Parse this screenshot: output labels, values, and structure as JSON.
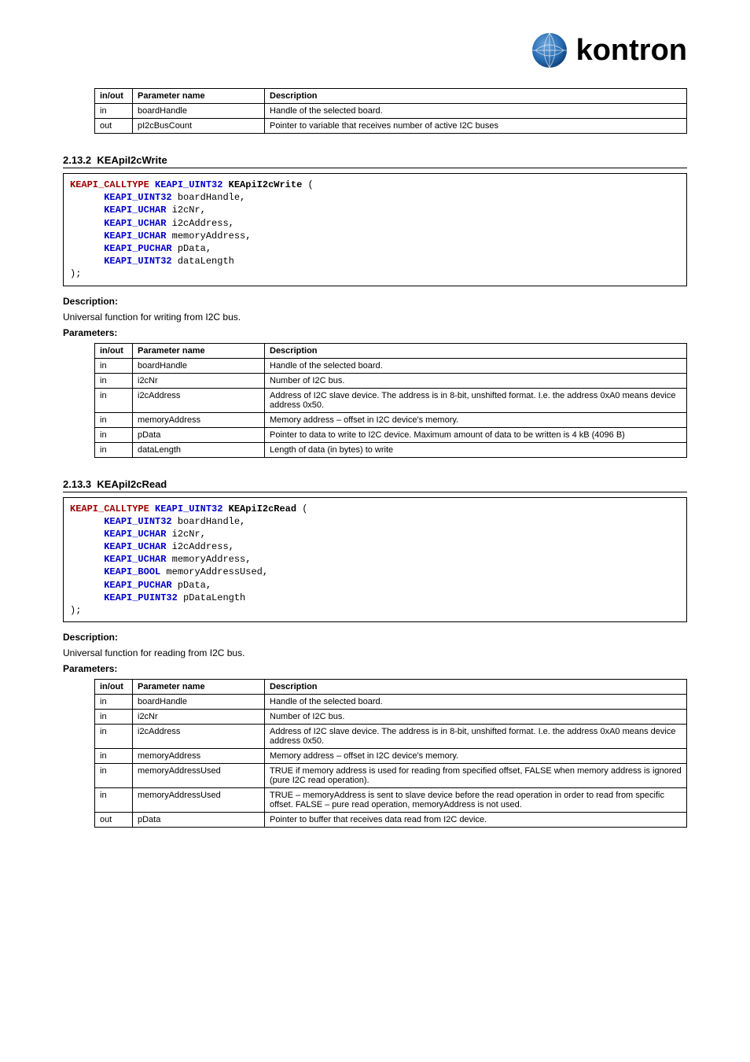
{
  "logo_text": "kontron",
  "table_intro": {
    "headers": [
      "in/out",
      "Parameter name",
      "Description"
    ],
    "rows": [
      [
        "in",
        "boardHandle",
        "Handle of the selected board."
      ],
      [
        "out",
        "pI2cBusCount",
        "Pointer to variable that receives number of active I2C buses"
      ]
    ]
  },
  "section_write": {
    "number": "2.13.2",
    "title": "KEApiI2cWrite",
    "code_fn": "KEApiI2cWrite",
    "code_params": [
      [
        "KEAPI_UINT32",
        "boardHandle,"
      ],
      [
        "KEAPI_UCHAR",
        "i2cNr,"
      ],
      [
        "KEAPI_UCHAR",
        "i2cAddress,"
      ],
      [
        "KEAPI_UCHAR",
        "memoryAddress,"
      ],
      [
        "KEAPI_PUCHAR",
        "pData,"
      ],
      [
        "KEAPI_UINT32",
        "dataLength"
      ]
    ],
    "desc_label": "Description:",
    "desc": "Universal function for writing from I2C bus.",
    "params_label": "Parameters:",
    "table": {
      "headers": [
        "in/out",
        "Parameter name",
        "Description"
      ],
      "rows": [
        [
          "in",
          "boardHandle",
          "Handle of the selected board."
        ],
        [
          "in",
          "i2cNr",
          "Number of I2C bus."
        ],
        [
          "in",
          "i2cAddress",
          "Address of I2C slave device. The address is in 8-bit, unshifted format. I.e. the address 0xA0 means device address 0x50."
        ],
        [
          "in",
          "memoryAddress",
          "Memory address – offset in I2C device's memory."
        ],
        [
          "in",
          "pData",
          "Pointer to data to write to I2C device. Maximum amount of data to be written is 4 kB (4096 B)"
        ],
        [
          "in",
          "dataLength",
          "Length of data (in bytes) to write"
        ]
      ]
    }
  },
  "section_read": {
    "number": "2.13.3",
    "title": "KEApiI2cRead",
    "code_fn": "KEApiI2cRead",
    "code_params": [
      [
        "KEAPI_UINT32",
        "boardHandle,"
      ],
      [
        "KEAPI_UCHAR",
        "i2cNr,"
      ],
      [
        "KEAPI_UCHAR",
        "i2cAddress,"
      ],
      [
        "KEAPI_UCHAR",
        "memoryAddress,"
      ],
      [
        "KEAPI_BOOL",
        "memoryAddressUsed,"
      ],
      [
        "KEAPI_PUCHAR",
        "pData,"
      ],
      [
        "KEAPI_PUINT32",
        "pDataLength"
      ]
    ],
    "desc_label": "Description:",
    "desc": "Universal function for reading from I2C bus.",
    "params_label": "Parameters:",
    "table": {
      "headers": [
        "in/out",
        "Parameter name",
        "Description"
      ],
      "rows": [
        [
          "in",
          "boardHandle",
          "Handle of the selected board."
        ],
        [
          "in",
          "i2cNr",
          "Number of I2C bus."
        ],
        [
          "in",
          "i2cAddress",
          "Address of I2C slave device. The address is in 8-bit, unshifted format. I.e. the address 0xA0 means device address 0x50."
        ],
        [
          "in",
          "memoryAddress",
          "Memory address – offset in I2C device's memory."
        ],
        [
          "in",
          "memoryAddressUsed",
          "TRUE if memory address is used for reading from specified offset, FALSE when memory address is ignored (pure I2C read operation)."
        ],
        [
          "in",
          "memoryAddressUsed",
          "TRUE – memoryAddress is sent to slave device before the read operation in order to read from specific offset. FALSE – pure read operation, memoryAddress is not used."
        ],
        [
          "out",
          "pData",
          "Pointer to buffer that receives data read from I2C device."
        ]
      ]
    }
  },
  "code_prefix1": "KEAPI_CALLTYPE",
  "code_prefix2": "KEAPI_UINT32"
}
